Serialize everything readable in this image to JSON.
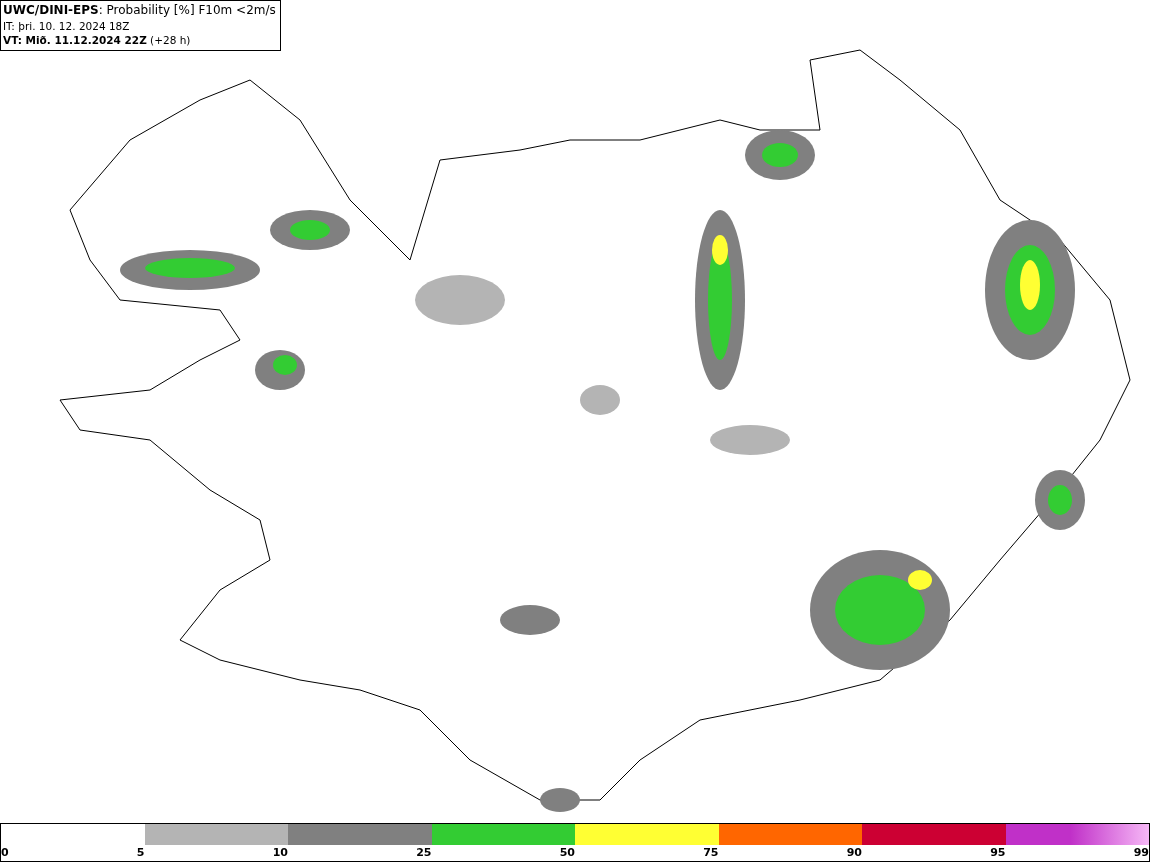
{
  "header": {
    "lines": [
      "**UWC/DINI-EPS**: Probability [%] F10m <2m/s",
      "IT: þri. 10. 12. 2024 18Z",
      "**VT: Mið. 11.12.2024 22Z** (+28 h)"
    ]
  },
  "legend": {
    "segments": [
      {
        "color": "#b4b4b4"
      },
      {
        "color": "#808080"
      },
      {
        "color": "#33cc33"
      },
      {
        "color": "#ffff33"
      },
      {
        "color": "#ff6600"
      },
      {
        "color": "#cc0033"
      },
      {
        "color": "#c030c8",
        "kind": "fade"
      }
    ],
    "ticks": [
      "0",
      "5",
      "10",
      "25",
      "50",
      "75",
      "90",
      "95",
      "99"
    ]
  }
}
